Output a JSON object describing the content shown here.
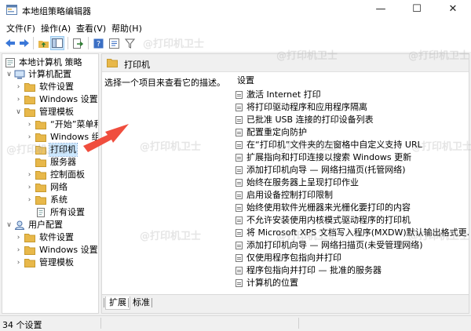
{
  "app": {
    "title": "本地组策略编辑器"
  },
  "window_controls": {
    "minimize": "—",
    "maximize": "☐",
    "close": "✕"
  },
  "menu": [
    "文件(F)",
    "操作(A)",
    "查看(V)",
    "帮助(H)"
  ],
  "toolbar": {
    "buttons": [
      "back-icon",
      "forward-icon",
      "up-folder-icon",
      "show-tree-icon",
      "export-icon",
      "help-icon",
      "properties-icon",
      "filter-icon"
    ]
  },
  "tree": {
    "root": "本地计算机 策略",
    "items": [
      {
        "label": "计算机配置"
      },
      {
        "label": "软件设置"
      },
      {
        "label": "Windows 设置"
      },
      {
        "label": "管理模板"
      },
      {
        "label": "“开始”菜单和"
      },
      {
        "label": "Windows 组"
      },
      {
        "label": "打印机"
      },
      {
        "label": "服务器"
      },
      {
        "label": "控制面板"
      },
      {
        "label": "网络"
      },
      {
        "label": "系统"
      },
      {
        "label": "所有设置"
      },
      {
        "label": "用户配置"
      },
      {
        "label": "软件设置"
      },
      {
        "label": "Windows 设置"
      },
      {
        "label": "管理模板"
      }
    ]
  },
  "right_pane": {
    "header_title": "打印机",
    "description": "选择一个项目来查看它的描述。",
    "column_header": "设置",
    "settings": [
      "激活 Internet 打印",
      "将打印驱动程序和应用程序隔离",
      "已批准 USB 连接的打印设备列表",
      "配置重定向防护",
      "在“打印机”文件夹的左窗格中自定义支持 URL",
      "扩展指向和打印连接以搜索 Windows 更新",
      "添加打印机向导 — 网络扫描页(托管网络)",
      "始终在服务器上呈现打印作业",
      "启用设备控制打印限制",
      "始终使用软件光栅器来光栅化要打印的内容",
      "不允许安装使用内核模式驱动程序的打印机",
      "将 Microsoft XPS 文档写入程序(MXDW)默认输出格式更...",
      "添加打印机向导 — 网络扫描页(未受管理网络)",
      "仅使用程序包指向并打印",
      "程序包指向并打印 — 批准的服务器",
      "计算机的位置"
    ],
    "tabs": [
      "扩展",
      "标准"
    ]
  },
  "status": {
    "text": "34 个设置"
  },
  "watermark": "@打印机卫士",
  "colors": {
    "folder": "#e8b84a",
    "selection": "#cce8ff",
    "arrow": "#f04e3e"
  }
}
